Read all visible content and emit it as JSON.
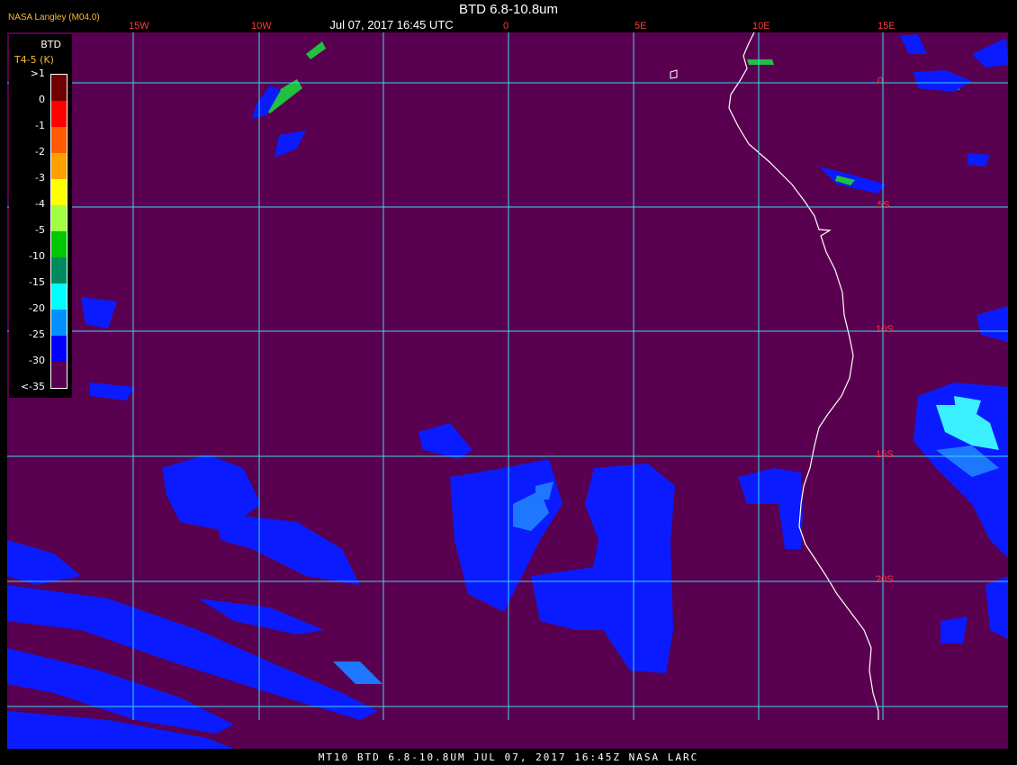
{
  "credit": "NASA Langley (M04.0)",
  "title": "BTD 6.8-10.8um",
  "subtitle": "Jul 07, 2017 16:45 UTC",
  "footer": "MT10  BTD 6.8-10.8UM  JUL 07, 2017 16:45Z  NASA LARC",
  "legend": {
    "title": "BTD",
    "subtitle": "T4-5 (K)",
    "labels": [
      ">1",
      "0",
      "-1",
      "-2",
      "-3",
      "-4",
      "-5",
      "-10",
      "-15",
      "-20",
      "-25",
      "-30",
      "<-35"
    ],
    "colors": [
      "#6e0000",
      "#ff0000",
      "#ff5a00",
      "#ffa000",
      "#ffff00",
      "#a0ff40",
      "#00c800",
      "#008a60",
      "#00ffff",
      "#0090ff",
      "#0000ff",
      "#5a0050"
    ]
  },
  "colors": {
    "background": "#5a0050",
    "grid": "#3ad8f0",
    "coast": "#ffffff",
    "cloud_deep": "#0a1cff",
    "cloud_mid": "#1e78ff",
    "cloud_cyan": "#3af0ff",
    "cloud_green": "#20c040"
  },
  "grid": {
    "lon_labels": [
      "15W",
      "10W",
      "0",
      "5E",
      "10E",
      "15E"
    ],
    "lat_labels": [
      "0",
      "5S",
      "10S",
      "15S",
      "20S"
    ]
  }
}
